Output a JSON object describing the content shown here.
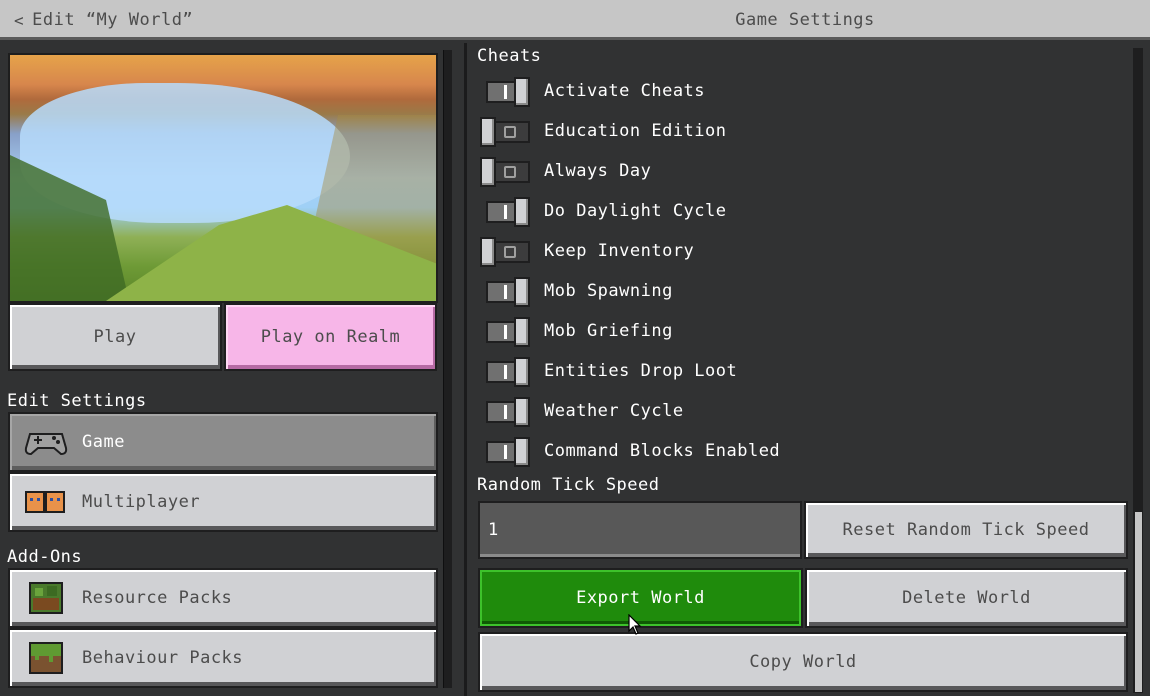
{
  "titlebar": {
    "back_label": "Edit “My World”",
    "page_title": "Game Settings"
  },
  "left": {
    "play_label": "Play",
    "realm_label": "Play on Realm",
    "edit_settings_heading": "Edit Settings",
    "nav": [
      {
        "label": "Game",
        "icon": "gamepad-icon",
        "active": true
      },
      {
        "label": "Multiplayer",
        "icon": "players-icon",
        "active": false
      }
    ],
    "addons_heading": "Add-Ons",
    "addons": [
      {
        "label": "Resource Packs",
        "icon": "resource-pack-icon"
      },
      {
        "label": "Behaviour Packs",
        "icon": "grass-block-icon"
      }
    ]
  },
  "cheats": {
    "heading": "Cheats",
    "toggles": [
      {
        "label": "Activate Cheats",
        "on": true
      },
      {
        "label": "Education Edition",
        "on": false
      },
      {
        "label": "Always Day",
        "on": false
      },
      {
        "label": "Do Daylight Cycle",
        "on": true
      },
      {
        "label": "Keep Inventory",
        "on": false
      },
      {
        "label": "Mob Spawning",
        "on": true
      },
      {
        "label": "Mob Griefing",
        "on": true
      },
      {
        "label": "Entities Drop Loot",
        "on": true
      },
      {
        "label": "Weather Cycle",
        "on": true
      },
      {
        "label": "Command Blocks Enabled",
        "on": true
      }
    ]
  },
  "random_tick": {
    "heading": "Random Tick Speed",
    "value": "1",
    "reset_label": "Reset Random Tick Speed"
  },
  "actions": {
    "export_label": "Export World",
    "delete_label": "Delete World",
    "copy_label": "Copy World"
  },
  "colors": {
    "export_green": "#1f8b0c",
    "realm_pink": "#f7b6e8",
    "background": "#313233"
  }
}
